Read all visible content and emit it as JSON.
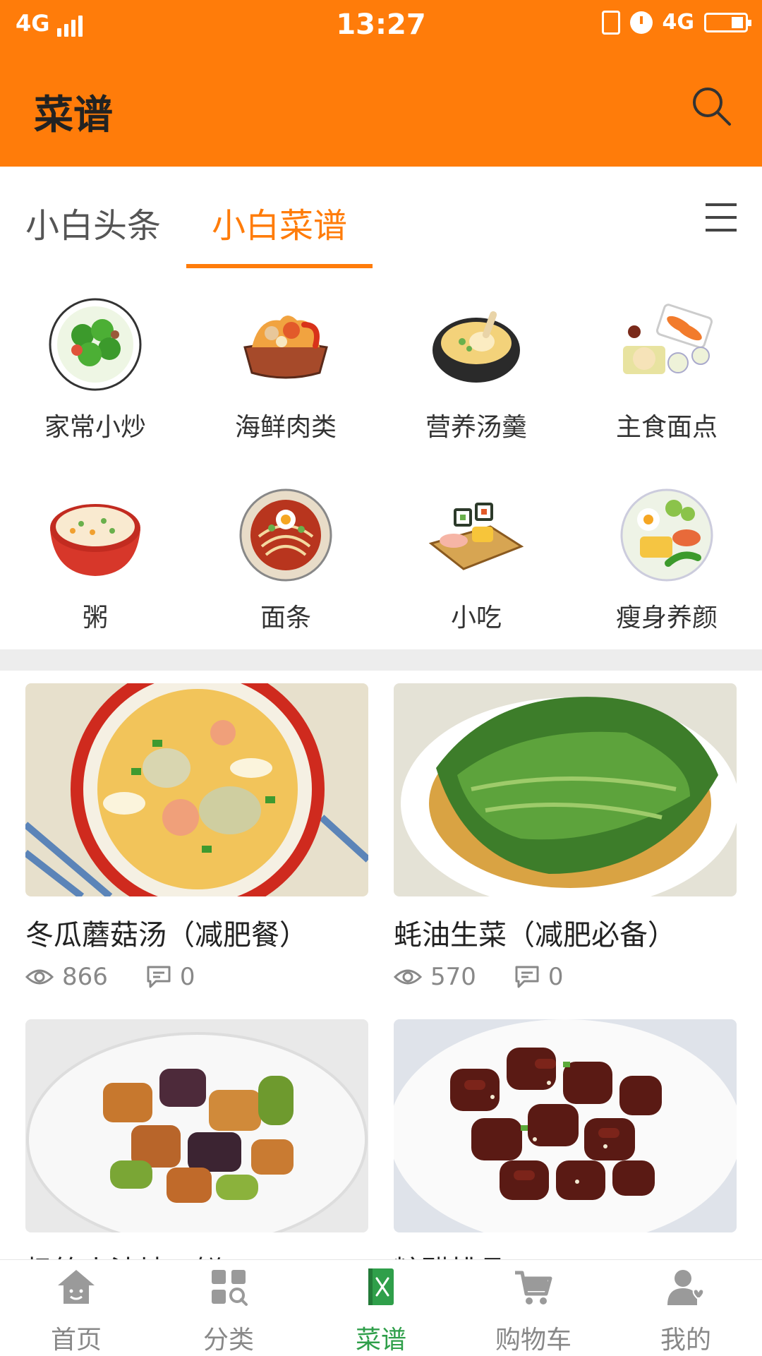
{
  "status_bar": {
    "network_left": "4G",
    "time": "13:27",
    "network_right": "4G"
  },
  "header": {
    "title": "菜谱"
  },
  "tabs": [
    {
      "label": "小白头条",
      "active": false
    },
    {
      "label": "小白菜谱",
      "active": true
    }
  ],
  "categories": [
    {
      "label": "家常小炒",
      "icon": "stir-fry-dish-icon"
    },
    {
      "label": "海鲜肉类",
      "icon": "seafood-pot-icon"
    },
    {
      "label": "营养汤羹",
      "icon": "soup-pot-icon"
    },
    {
      "label": "主食面点",
      "icon": "pastry-plate-icon"
    },
    {
      "label": "粥",
      "icon": "porridge-bowl-icon"
    },
    {
      "label": "面条",
      "icon": "noodle-bowl-icon"
    },
    {
      "label": "小吃",
      "icon": "sushi-board-icon"
    },
    {
      "label": "瘦身养颜",
      "icon": "healthy-plate-icon"
    }
  ],
  "recipes": [
    {
      "title": "冬瓜蘑菇汤（减肥餐）",
      "views": "866",
      "comments": "0"
    },
    {
      "title": "蚝油生菜（减肥必备）",
      "views": "570",
      "comments": "0"
    },
    {
      "title": "极简小油地三鲜",
      "views": "",
      "comments": ""
    },
    {
      "title": "糖醋排骨",
      "views": "",
      "comments": ""
    }
  ],
  "bottom_nav": [
    {
      "label": "首页",
      "icon": "home-icon",
      "active": false
    },
    {
      "label": "分类",
      "icon": "category-icon",
      "active": false
    },
    {
      "label": "菜谱",
      "icon": "recipe-book-icon",
      "active": true
    },
    {
      "label": "购物车",
      "icon": "cart-icon",
      "active": false
    },
    {
      "label": "我的",
      "icon": "profile-icon",
      "active": false
    }
  ],
  "colors": {
    "accent": "#ff7c0a",
    "nav_active": "#2f9f4a",
    "text": "#333333"
  }
}
